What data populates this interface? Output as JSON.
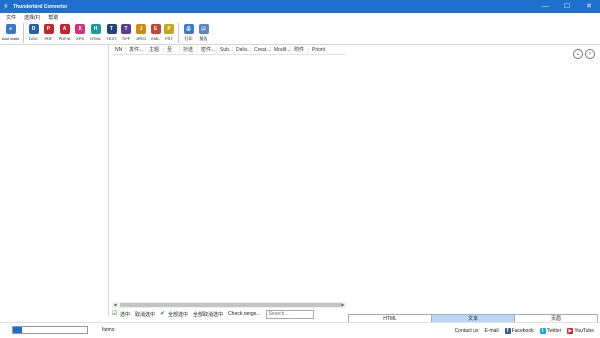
{
  "window": {
    "title": "Thunderbird Converter",
    "minimize": "—",
    "maximize": "☐",
    "close": "✕"
  },
  "menu": [
    "文件",
    "选择(F)",
    "帮助"
  ],
  "toolbar": [
    {
      "label": "Add mails",
      "icon": "add-mails-icon",
      "color": "#3a78c8",
      "glyph": "●"
    },
    {
      "label": "DOC",
      "icon": "doc-icon",
      "color": "#2a5db0",
      "glyph": "D"
    },
    {
      "label": "PDF",
      "icon": "pdf-icon",
      "color": "#c0262d",
      "glyph": "P"
    },
    {
      "label": "PDF/A",
      "icon": "pdfa-icon",
      "color": "#c0262d",
      "glyph": "A"
    },
    {
      "label": "XPS",
      "icon": "xps-icon",
      "color": "#d1337a",
      "glyph": "X"
    },
    {
      "label": "HTML",
      "icon": "html-icon",
      "color": "#1b9a9a",
      "glyph": "H"
    },
    {
      "label": "TEXT",
      "icon": "text-icon",
      "color": "#23437a",
      "glyph": "T"
    },
    {
      "label": "TIFF",
      "icon": "tiff-icon",
      "color": "#5b3b8e",
      "glyph": "T"
    },
    {
      "label": "JPEG",
      "icon": "jpeg-icon",
      "color": "#d08a10",
      "glyph": "J"
    },
    {
      "label": "EML",
      "icon": "eml-icon",
      "color": "#c04a2a",
      "glyph": "E"
    },
    {
      "label": "PST",
      "icon": "pst-icon",
      "color": "#c9a21a",
      "glyph": "P"
    },
    {
      "label": "打印",
      "icon": "print-icon",
      "color": "#3a78c8",
      "glyph": "⎙"
    },
    {
      "label": "报告",
      "icon": "report-icon",
      "color": "#5a86c6",
      "glyph": "▤"
    }
  ],
  "grid": {
    "columns": [
      "NN",
      "发件...",
      "主题",
      "至",
      "抄送",
      "密件...",
      "Sub...",
      "Deliv...",
      "Creat...",
      "Modif...",
      "附件",
      "Priorit"
    ]
  },
  "viewer_tabs": [
    {
      "label": "HTML",
      "active": false
    },
    {
      "label": "文本",
      "active": true
    },
    {
      "label": "页眉",
      "active": false
    }
  ],
  "bottom": {
    "select_all": "选中",
    "deselect_all": "取消选中",
    "select_all_folders": "全部选中",
    "deselect_all_folders": "全部取消选中",
    "check_range": "Check range...",
    "search_placeholder": "Search..."
  },
  "status": {
    "items_label": "Items:",
    "progress": 0.12,
    "contact_us": "Contact us",
    "email": "E-mail",
    "facebook": "Facebook",
    "twitter": "Twitter",
    "youtube": "YouTube"
  }
}
